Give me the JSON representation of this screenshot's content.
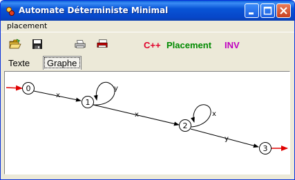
{
  "window": {
    "title": "Automate Déterministe Minimal"
  },
  "menu": {
    "items": [
      "placement"
    ]
  },
  "toolbar": {
    "cpp_label": "C++",
    "placement_label": "Placement",
    "inv_label": "INV",
    "colors": {
      "cpp": "#e0002a",
      "placement": "#008a00",
      "inv": "#c000c0"
    }
  },
  "tabs": {
    "texte": "Texte",
    "graphe": "Graphe",
    "active": "Graphe"
  },
  "graph": {
    "states": [
      "0",
      "1",
      "2",
      "3"
    ],
    "initial": "0",
    "final": "3",
    "transitions": [
      {
        "from": "0",
        "to": "1",
        "label": "x"
      },
      {
        "from": "1",
        "to": "1",
        "label": "y"
      },
      {
        "from": "1",
        "to": "2",
        "label": "x"
      },
      {
        "from": "2",
        "to": "2",
        "label": "x"
      },
      {
        "from": "2",
        "to": "3",
        "label": "y"
      }
    ]
  }
}
